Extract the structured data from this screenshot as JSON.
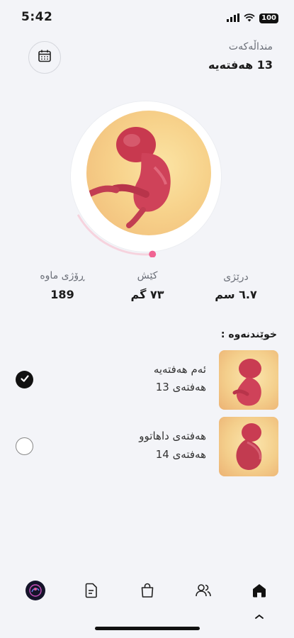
{
  "status_bar": {
    "time": "5:42",
    "battery": "100"
  },
  "header": {
    "label": "منداڵەکەت",
    "week": "13 هەفتەیە"
  },
  "progress": {
    "fraction": 0.18
  },
  "stats": [
    {
      "label": "درێژی",
      "value": "٦.٧  سم"
    },
    {
      "label": "کێش",
      "value": "٧٣  گم"
    },
    {
      "label": "ڕۆژی ماوە",
      "value": "189"
    }
  ],
  "readings": {
    "title": "خوێندنەوە :",
    "items": [
      {
        "title": "ئەم هەفتەیە",
        "subtitle": "هەفتەی 13",
        "checked": true
      },
      {
        "title": "هەفتەی داهاتوو",
        "subtitle": "هەفتەی 14",
        "checked": false
      }
    ]
  },
  "nav": {
    "items": [
      "profile",
      "notes",
      "shop",
      "community",
      "home"
    ],
    "active": "home"
  },
  "colors": {
    "accent": "#f06493",
    "background": "#f3f4f8"
  }
}
